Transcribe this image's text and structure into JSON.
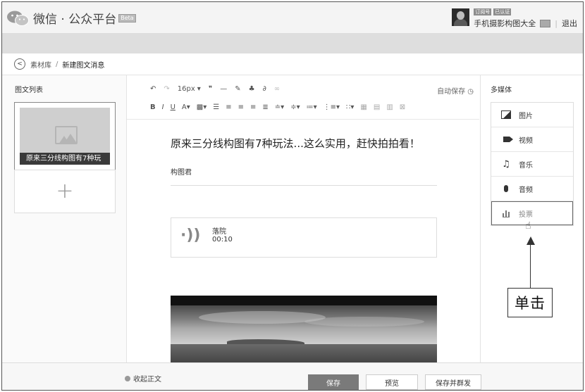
{
  "header": {
    "title": "微信 · 公众平台",
    "beta": "Beta",
    "tags": [
      "订阅号",
      "已认证"
    ],
    "account_name": "手机摄影构图大全",
    "logout": "退出"
  },
  "breadcrumb": {
    "parent": "素材库",
    "separator": "/",
    "current": "新建图文消息"
  },
  "left_panel": {
    "title": "图文列表",
    "card_caption": "原来三分线构图有7种玩",
    "add": "+"
  },
  "toolbar": {
    "font_size": "16px",
    "auto_save": "自动保存"
  },
  "article": {
    "title": "原来三分线构图有7种玩法...这么实用，赶快拍拍看！",
    "author": "构图君",
    "audio_name": "落院",
    "audio_time": "00:10"
  },
  "media_panel": {
    "title": "多媒体",
    "items": [
      {
        "label": "图片",
        "icon": "image-icon"
      },
      {
        "label": "视频",
        "icon": "video-icon"
      },
      {
        "label": "音乐",
        "icon": "music-icon"
      },
      {
        "label": "音频",
        "icon": "audio-icon"
      },
      {
        "label": "投票",
        "icon": "vote-icon"
      }
    ]
  },
  "annotation": {
    "callout": "单击"
  },
  "footer": {
    "collapse": "收起正文",
    "save": "保存",
    "preview": "预览",
    "save_publish": "保存并群发"
  }
}
